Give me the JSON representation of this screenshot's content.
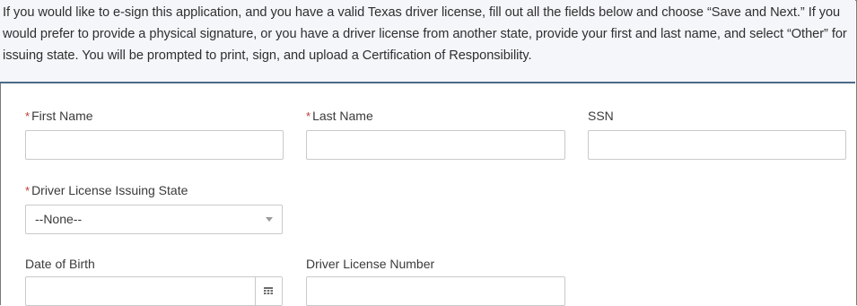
{
  "intro": {
    "text": "If you would like to e-sign this application, and you have a valid Texas driver license, fill out all the fields below and choose “Save and Next.” If you would prefer to provide a physical signature, or you have a driver license from another state, provide your first and last name, and select “Other” for issuing state. You will be prompted to print, sign, and upload a Certification of Responsibility."
  },
  "required_marker": "*",
  "fields": {
    "first_name": {
      "label": "First Name",
      "value": ""
    },
    "last_name": {
      "label": "Last Name",
      "value": ""
    },
    "ssn": {
      "label": "SSN",
      "value": ""
    },
    "issuing_state": {
      "label": "Driver License Issuing State",
      "selected": "--None--"
    },
    "dob": {
      "label": "Date of Birth",
      "value": ""
    },
    "license_number": {
      "label": "Driver License Number",
      "value": ""
    }
  },
  "icons": {
    "dropdown": "chevron-down-icon",
    "calendar": "calendar-icon"
  },
  "colors": {
    "required": "#c23934",
    "intro_bg": "#f4f6f9",
    "divider": "#4b6b8a",
    "input_border": "#c9c9c9"
  }
}
